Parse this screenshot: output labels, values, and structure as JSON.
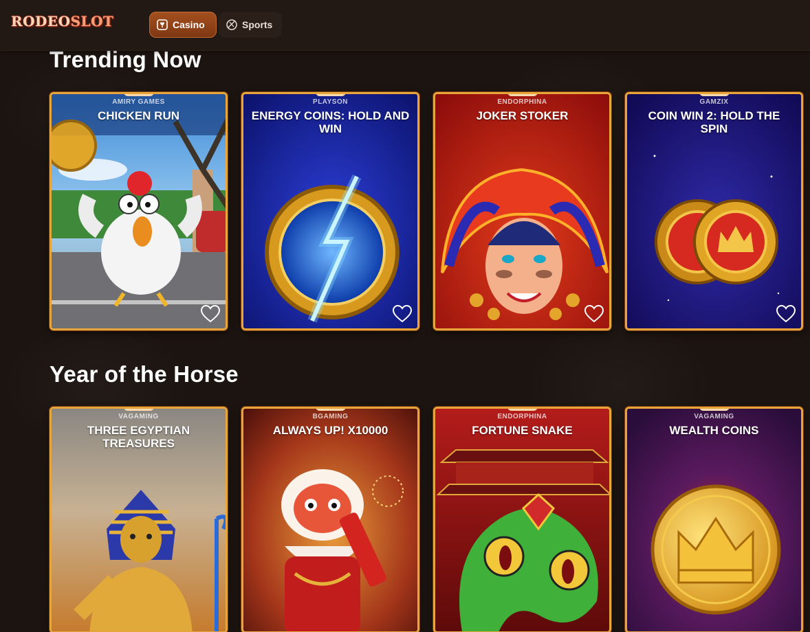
{
  "header": {
    "logo_a": "RODEO",
    "logo_b": "SLOT",
    "nav": [
      {
        "label": "Casino",
        "active": true
      },
      {
        "label": "Sports",
        "active": false
      }
    ]
  },
  "sections": [
    {
      "title": "Trending Now",
      "games": [
        {
          "provider": "AMIRY GAMES",
          "title": "CHICKEN RUN"
        },
        {
          "provider": "PLAYSON",
          "title": "ENERGY COINS: HOLD AND WIN"
        },
        {
          "provider": "ENDORPHINA",
          "title": "JOKER STOKER"
        },
        {
          "provider": "GAMZIX",
          "title": "COIN WIN 2: HOLD THE SPIN"
        }
      ]
    },
    {
      "title": "Year of the Horse",
      "games": [
        {
          "provider": "VAGAMING",
          "title": "THREE EGYPTIAN TREASURES"
        },
        {
          "provider": "BGAMING",
          "title": "ALWAYS UP! X10000"
        },
        {
          "provider": "ENDORPHINA",
          "title": "FORTUNE SNAKE"
        },
        {
          "provider": "VAGAMING",
          "title": "WEALTH COINS"
        }
      ]
    }
  ],
  "colors": {
    "background": "#1c1410",
    "accent": "#a5501f",
    "card_border": "#e7a53c"
  },
  "icons": {
    "casino": "card-icon",
    "sports": "ball-icon",
    "favorite": "heart-icon"
  }
}
